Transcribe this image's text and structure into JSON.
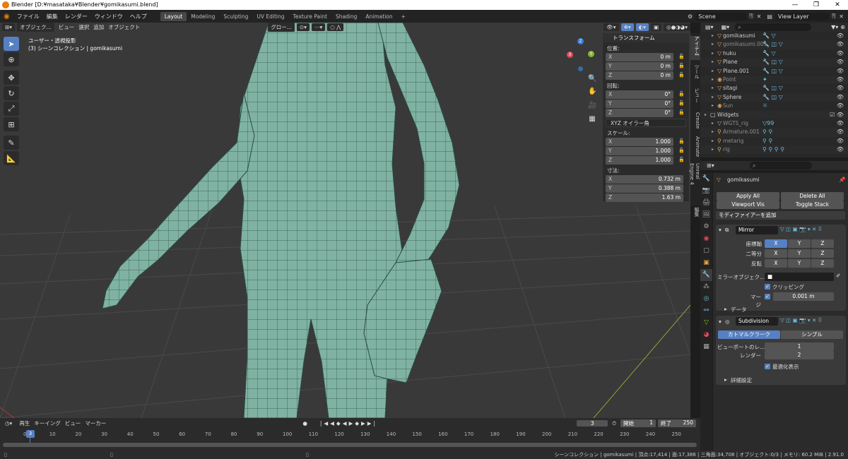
{
  "window": {
    "title": "Blender [D:¥masataka¥Blender¥gomikasumi.blend]",
    "controls": [
      "—",
      "❐",
      "✕"
    ]
  },
  "menus": [
    "ファイル",
    "編集",
    "レンダー",
    "ウィンドウ",
    "ヘルプ"
  ],
  "workspaces": [
    "Layout",
    "Modeling",
    "Sculpting",
    "UV Editing",
    "Texture Paint",
    "Shading",
    "Animation"
  ],
  "workspace_add": "+",
  "scene": {
    "name": "Scene",
    "view_layer": "View Layer"
  },
  "viewport": {
    "header": {
      "mode": "オブジェク...",
      "menus": [
        "ビュー",
        "選択",
        "追加",
        "オブジェクト"
      ],
      "orientation": "グロー..."
    },
    "info_line1": "ユーザー・透視投影",
    "info_line2": "(3) シーンコレクション | gomikasumi",
    "gizmo": {
      "x": "X",
      "y": "Y",
      "z": "Z"
    }
  },
  "npanel": {
    "header": "トランスフォーム",
    "location_label": "位置:",
    "location": [
      {
        "axis": "X",
        "value": "0 m"
      },
      {
        "axis": "Y",
        "value": "0 m"
      },
      {
        "axis": "Z",
        "value": "0 m"
      }
    ],
    "rotation_label": "回転:",
    "rotation": [
      {
        "axis": "X",
        "value": "0°"
      },
      {
        "axis": "Y",
        "value": "0°"
      },
      {
        "axis": "Z",
        "value": "0°"
      }
    ],
    "rotation_mode": "XYZ オイラー角",
    "scale_label": "スケール:",
    "scale": [
      {
        "axis": "X",
        "value": "1.000"
      },
      {
        "axis": "Y",
        "value": "1.000"
      },
      {
        "axis": "Z",
        "value": "1.000"
      }
    ],
    "dimensions_label": "寸法:",
    "dimensions": [
      {
        "axis": "X",
        "value": "0.732 m"
      },
      {
        "axis": "Y",
        "value": "0.388 m"
      },
      {
        "axis": "Z",
        "value": "1.63 m"
      }
    ]
  },
  "sidetabs": [
    "アイテム",
    "ツール",
    "ビュー",
    "Create",
    "Animate",
    "Unreal Engine 4",
    "編集"
  ],
  "timeline": {
    "menus": [
      "再生",
      "キーイング",
      "ビュー",
      "マーカー"
    ],
    "current_frame": "3",
    "start_label": "開始",
    "start": "1",
    "end_label": "終了",
    "end": "250",
    "ticks": [
      "0",
      "10",
      "20",
      "30",
      "40",
      "50",
      "60",
      "70",
      "80",
      "90",
      "100",
      "110",
      "120",
      "130",
      "140",
      "150",
      "160",
      "170",
      "180",
      "190",
      "200",
      "210",
      "220",
      "230",
      "240",
      "250"
    ],
    "indicator": "3"
  },
  "status": "シーンコレクション | gomikasumi | 頂点:17,414 | 面:17,386 | 三角面:34,708 | オブジェクト:0/3 | メモリ: 60.2 MiB | 2.91.0",
  "outliner": {
    "rows": [
      {
        "name": "gomikasumi",
        "dim": false,
        "icon": "▽",
        "mods": "🔧 ▽"
      },
      {
        "name": "gomikasumi.001",
        "dim": true,
        "icon": "▽",
        "mods": "🔧 ◫ ▽"
      },
      {
        "name": "huku",
        "dim": false,
        "icon": "▽",
        "mods": "🔧 ▽"
      },
      {
        "name": "Plane",
        "dim": false,
        "icon": "▽",
        "mods": "🔧 ◫ ▽"
      },
      {
        "name": "Plane.001",
        "dim": false,
        "icon": "▽",
        "mods": "🔧 ◫ ▽"
      },
      {
        "name": "Point",
        "dim": true,
        "icon": "◉",
        "mods": "✦"
      },
      {
        "name": "sitagi",
        "dim": false,
        "icon": "▽",
        "mods": "🔧 ◫ ▽"
      },
      {
        "name": "Sphere",
        "dim": false,
        "icon": "▽",
        "mods": "🔧 ◫ ▽"
      },
      {
        "name": "Sun",
        "dim": true,
        "icon": "◉",
        "mods": "☼"
      },
      {
        "name": "Widgets",
        "dim": false,
        "icon": "▢",
        "mods": ""
      },
      {
        "name": "WGTS_rig",
        "dim": true,
        "icon": "▽",
        "mods": "▽99"
      },
      {
        "name": "Armature.001",
        "dim": true,
        "icon": "⚲",
        "mods": "⚲ ⚲"
      },
      {
        "name": "metarig",
        "dim": true,
        "icon": "⚲",
        "mods": "⚲ ⚲"
      },
      {
        "name": "rig",
        "dim": true,
        "icon": "⚲",
        "mods": "⚲ ⚲ ⚲ ⚲"
      }
    ]
  },
  "properties": {
    "object_name": "gomikasumi",
    "apply_all": "Apply All",
    "delete_all": "Delete All",
    "viewport_vis": "Viewport Vis",
    "toggle_stack": "Toggle Stack",
    "add_modifier": "モディファイアーを追加",
    "mirror": {
      "name": "Mirror",
      "axis_label": "座標軸",
      "bisect_label": "二等分",
      "flip_label": "反転",
      "axes": [
        "X",
        "Y",
        "Z"
      ],
      "mirror_object_label": "ミラーオブジェク...",
      "clipping_label": "クリッピング",
      "merge_label": "マージ",
      "merge_value": "0.001 m",
      "data_label": "データ"
    },
    "subdivision": {
      "name": "Subdivision",
      "catmull": "カトマルクラーク",
      "simple": "シンプル",
      "viewport_label": "ビューポートのレ...",
      "viewport_value": "1",
      "render_label": "レンダー",
      "render_value": "2",
      "optimal_label": "最適化表示",
      "advanced_label": "詳細設定"
    }
  }
}
